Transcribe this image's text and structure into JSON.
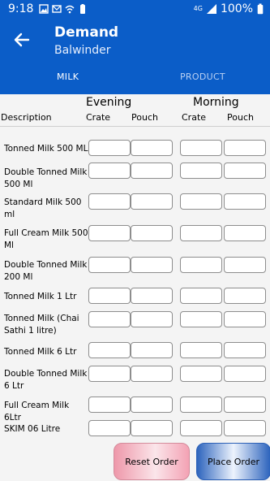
{
  "status_bar": {
    "time": "9:18",
    "network": "4G",
    "battery": "100%",
    "icons": [
      "gallery-icon",
      "email-icon",
      "wifi-icon",
      "battery-saver-icon",
      "signal-icon",
      "battery-icon"
    ]
  },
  "header": {
    "title": "Demand",
    "subtitle": "Balwinder",
    "back_icon": "back-arrow-icon",
    "color": "#0b5dc8"
  },
  "tabs": [
    {
      "label": "MILK",
      "active": true
    },
    {
      "label": "PRODUCT",
      "active": false
    }
  ],
  "table": {
    "description_header": "Description",
    "groups": [
      "Evening",
      "Morning"
    ],
    "subcolumns": [
      "Crate",
      "Pouch"
    ],
    "rows": [
      {
        "label": "Tonned Milk 500 ML"
      },
      {
        "label": "Double Tonned Milk 500 Ml"
      },
      {
        "label": "Standard Milk 500 ml"
      },
      {
        "label": "Full Cream Milk 500 Ml"
      },
      {
        "label": "Double Tonned Milk 200 Ml"
      },
      {
        "label": "Tonned Milk 1 Ltr"
      },
      {
        "label": "Tonned Milk (Chai Sathi 1 litre)"
      },
      {
        "label": "Tonned Milk 6 Ltr"
      },
      {
        "label": "Double Tonned Milk 6 Ltr"
      },
      {
        "label": "Full Cream Milk 6Ltr"
      },
      {
        "label": "SKIM 06 Litre"
      }
    ]
  },
  "actions": {
    "reset_label": "Reset Order",
    "place_label": "Place Order"
  }
}
